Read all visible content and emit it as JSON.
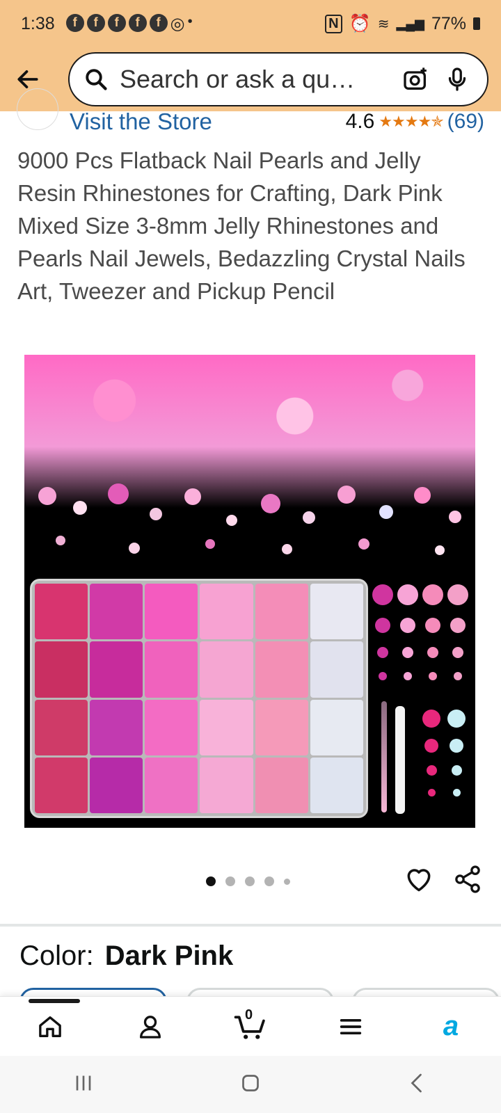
{
  "status_bar": {
    "time": "1:38",
    "battery": "77%"
  },
  "header": {
    "search_placeholder": "Search or ask a qu…"
  },
  "store": {
    "link_label": "Visit the Store",
    "rating": "4.6",
    "stars": "★★★★✯",
    "review_count": "(69)"
  },
  "product": {
    "title": "9000 Pcs Flatback Nail Pearls and Jelly Resin Rhinestones for Crafting, Dark Pink Mixed Size 3-8mm Jelly Rhinestones and Pearls Nail Jewels, Bedazzling Crystal Nails Art, Tweezer and Pickup Pencil"
  },
  "carousel": {
    "dots": 5,
    "active_index": 0
  },
  "color": {
    "label": "Color:",
    "value": "Dark Pink"
  },
  "bottom_nav": {
    "cart_count": "0"
  },
  "colors": {
    "header_bg": "#f5c58b",
    "link": "#2162a1",
    "star": "#e47911",
    "alexa": "#00a8e1"
  }
}
